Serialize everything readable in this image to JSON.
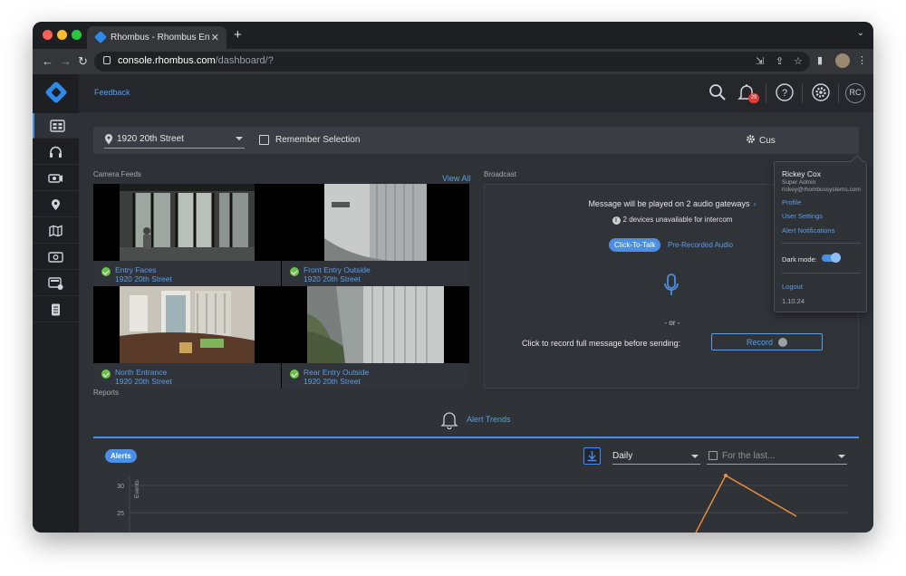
{
  "browser": {
    "tab_title": "Rhombus - Rhombus Enterprise",
    "tab_close": "✕",
    "new_tab": "+",
    "tab_dropdown": "⌄",
    "url_host": "console.rhombus.com",
    "url_path": "/dashboard/?"
  },
  "header": {
    "feedback": "Feedback",
    "notification_count": "29",
    "avatar_initials": "RC"
  },
  "sidebar": {
    "items": [
      "dashboard",
      "headset",
      "cameras",
      "locations",
      "map",
      "access-control",
      "devices",
      "reports"
    ]
  },
  "location_bar": {
    "location": "1920 20th Street",
    "remember_label": "Remember Selection",
    "customize_label": "Cus"
  },
  "camera_feeds": {
    "section_label": "Camera Feeds",
    "view_all": "View All",
    "feeds": [
      {
        "name": "Entry Faces",
        "address": "1920 20th Street"
      },
      {
        "name": "Front Entry Outside",
        "address": "1920 20th Street"
      },
      {
        "name": "North Entrance",
        "address": "1920 20th Street"
      },
      {
        "name": "Rear Entry Outside",
        "address": "1920 20th Street"
      }
    ]
  },
  "broadcast": {
    "section_label": "Broadcast",
    "message": "Message will be played on 2 audio gateways",
    "warning": "2 devices unavailable for intercom",
    "tab_click_to_talk": "Click-To-Talk",
    "tab_prerecorded": "Pre-Recorded Audio",
    "or_text": "- or -",
    "record_instruction": "Click to record full message before sending:",
    "record_button": "Record"
  },
  "reports": {
    "section_label": "Reports",
    "alert_trends": "Alert Trends",
    "alerts_chip": "Alerts",
    "interval": "Daily",
    "range_placeholder": "For the last...",
    "y_axis_label": "Events",
    "y_ticks": [
      "30",
      "25"
    ]
  },
  "user_menu": {
    "name": "Rickey Cox",
    "role": "Super Admin",
    "email": "rickey@rhombussystems.com",
    "links": [
      "Profile",
      "User Settings",
      "Alert Notifications"
    ],
    "dark_mode_label": "Dark mode:",
    "dark_mode_on": true,
    "logout": "Logout",
    "version": "1.10.24"
  },
  "colors": {
    "accent": "#4a8ee6",
    "status_ok": "#6cc04a",
    "badge": "#e53935",
    "trend_line": "#f0903a"
  }
}
